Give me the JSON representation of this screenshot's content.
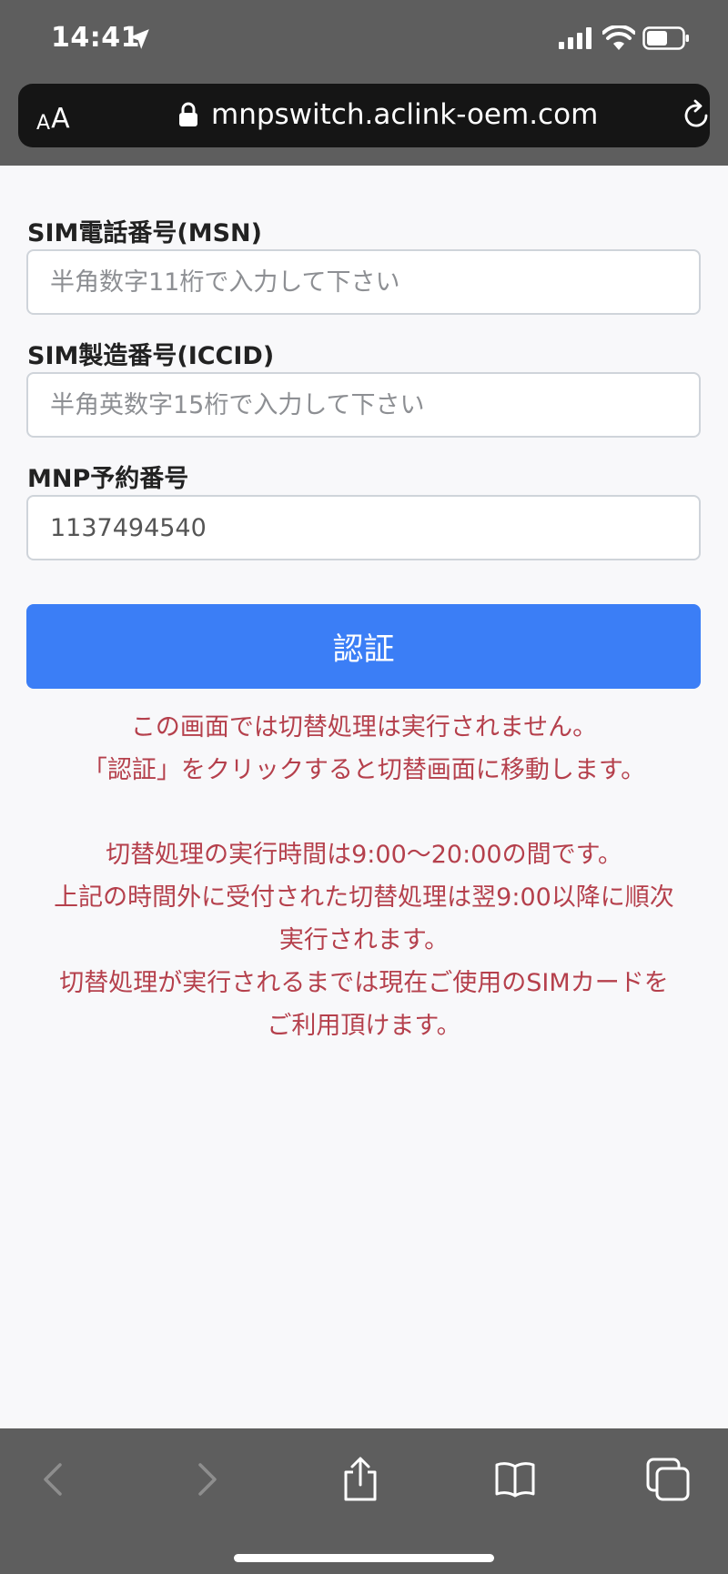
{
  "status_bar": {
    "time": "14:41"
  },
  "browser": {
    "text_size_label_small": "A",
    "text_size_label_large": "A",
    "url": "mnpswitch.aclink-oem.com"
  },
  "form": {
    "msn": {
      "label": "SIM電話番号(MSN)",
      "placeholder": "半角数字11桁で入力して下さい",
      "value": ""
    },
    "iccid": {
      "label": "SIM製造番号(ICCID)",
      "placeholder": "半角英数字15桁で入力して下さい",
      "value": ""
    },
    "mnp": {
      "label": "MNP予約番号",
      "placeholder": "",
      "value": "1137494540"
    },
    "submit_label": "認証"
  },
  "notices": [
    "この画面では切替処理は実行されません。",
    "「認証」をクリックすると切替画面に移動します。",
    "切替処理の実行時間は9:00〜20:00の間です。",
    "上記の時間外に受付された切替処理は翌9:00以降に順次",
    "実行されます。",
    "切替処理が実行されるまでは現在ご使用のSIMカードを",
    "ご利用頂けます。"
  ],
  "colors": {
    "accent": "#3b7ef6",
    "notice": "#b5404c",
    "chrome": "#5e5e5e"
  },
  "icons": {
    "status": [
      "location-arrow-icon",
      "signal-icon",
      "wifi-icon",
      "battery-icon"
    ],
    "url_bar": [
      "lock-icon",
      "reload-icon"
    ],
    "toolbar": [
      "back-icon",
      "forward-icon",
      "share-icon",
      "bookmarks-icon",
      "tabs-icon"
    ]
  }
}
